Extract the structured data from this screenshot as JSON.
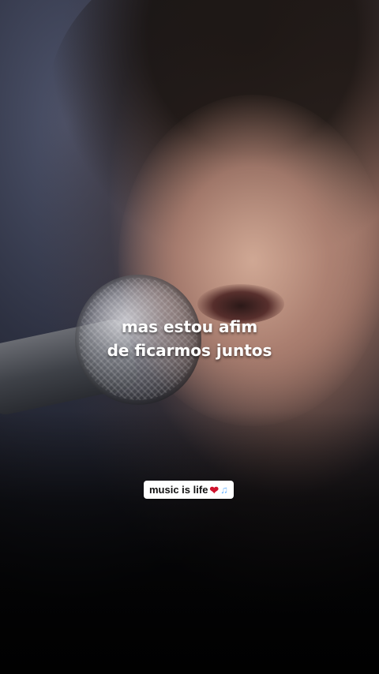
{
  "caption": {
    "line1": "mas estou afim",
    "line2": "de ficarmos juntos"
  },
  "badge": {
    "text": "music is life",
    "heart_icon": "red-heart",
    "notes_icon": "musical-notes"
  },
  "colors": {
    "caption_text": "#ffffff",
    "badge_bg": "#ffffff",
    "heart": "#d0122d",
    "notes": "#6fb6ff"
  }
}
